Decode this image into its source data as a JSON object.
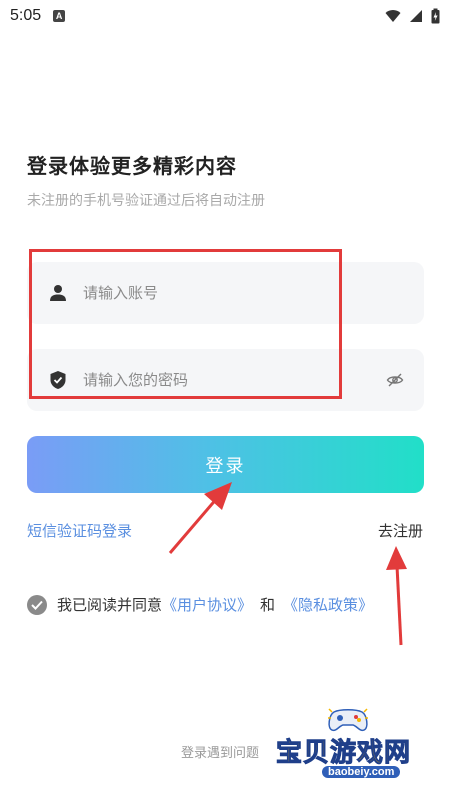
{
  "status_bar": {
    "time": "5:05",
    "notification_letter": "A"
  },
  "login": {
    "title": "登录体验更多精彩内容",
    "subtitle": "未注册的手机号验证通过后将自动注册",
    "account_placeholder": "请输入账号",
    "password_placeholder": "请输入您的密码",
    "login_button": "登录",
    "sms_login": "短信验证码登录",
    "register": "去注册",
    "agreement": {
      "prefix": "我已阅读并同意",
      "user_agreement": "《用户协议》",
      "and": "和",
      "privacy_policy": "《隐私政策》"
    },
    "help": "登录遇到问题"
  },
  "watermark": {
    "text": "宝贝游戏网",
    "domain": "baobeiy.com"
  },
  "colors": {
    "accent_link": "#5a8fe0",
    "button_gradient_start": "#7a9cf6",
    "button_gradient_end": "#21dfc8",
    "annotation_red": "#e23b3b"
  }
}
